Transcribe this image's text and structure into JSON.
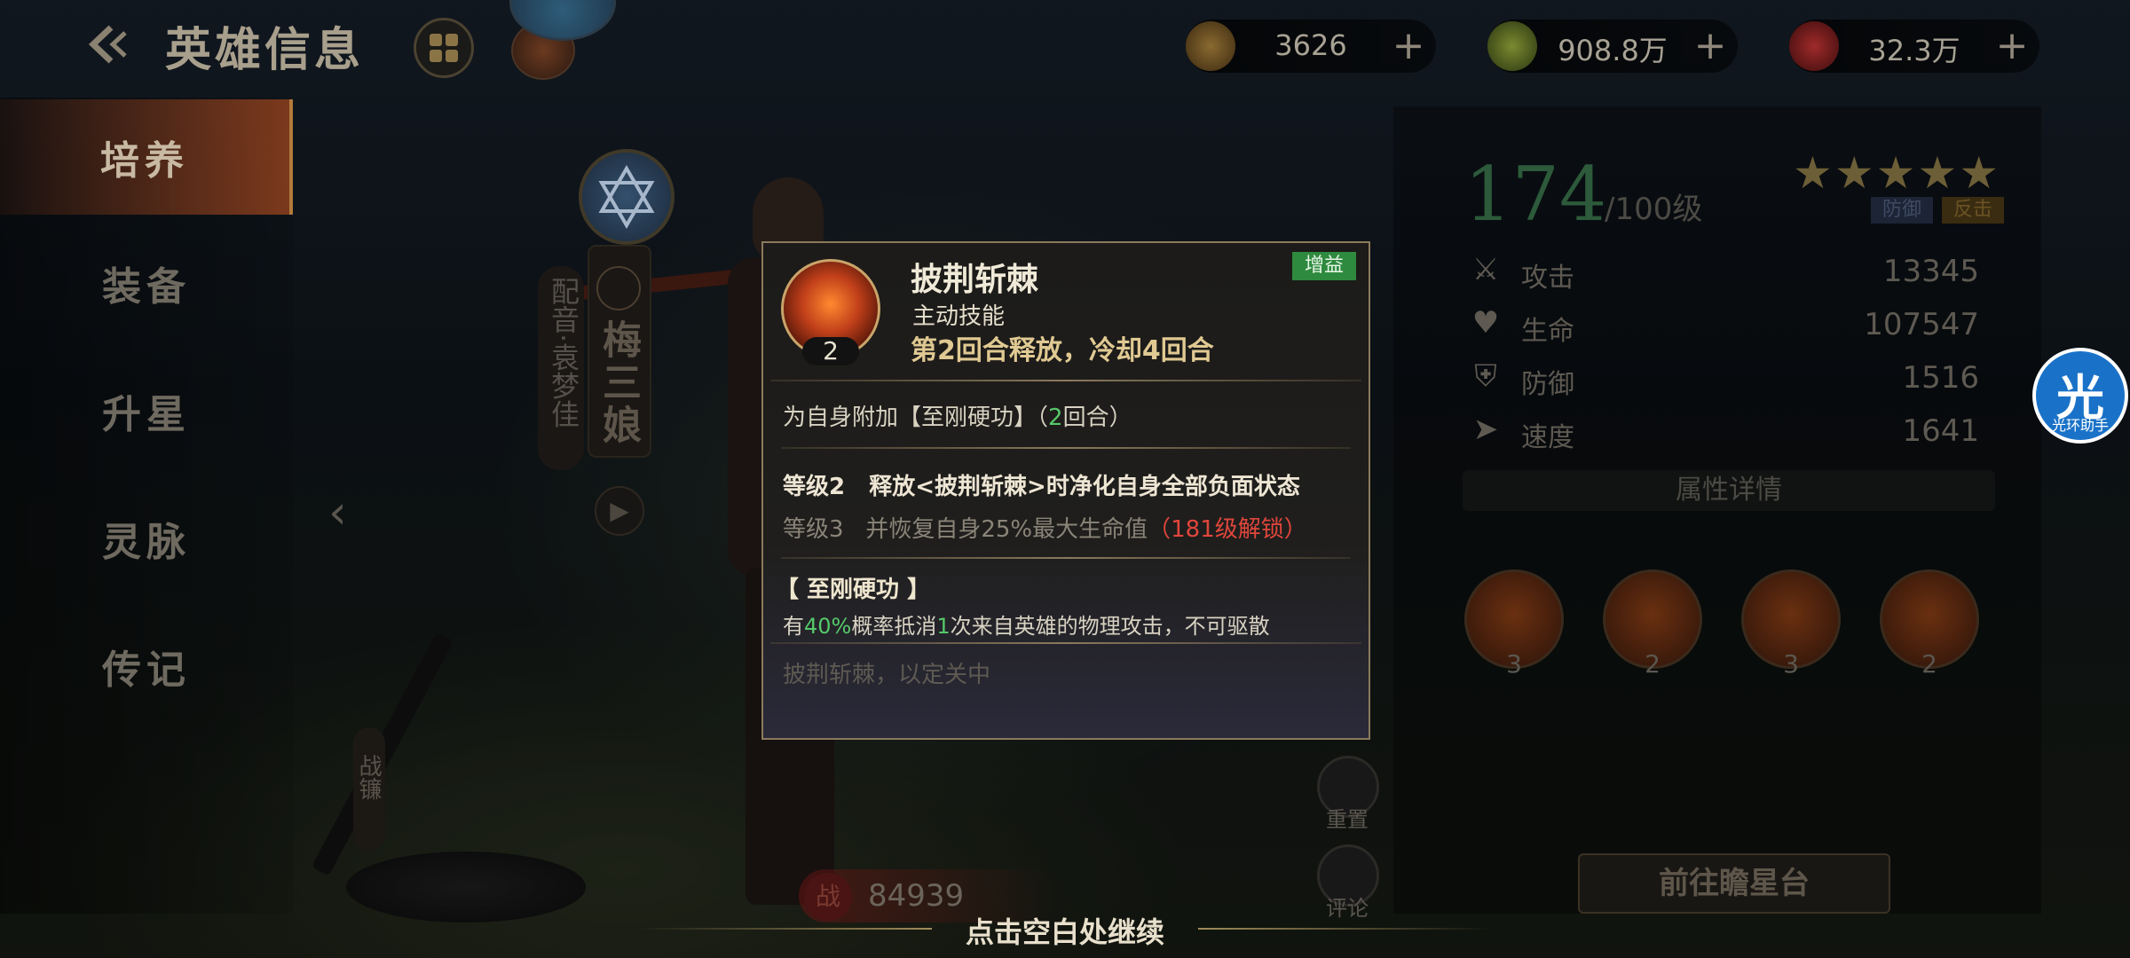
{
  "header": {
    "title": "英雄信息",
    "resources": [
      {
        "value": "3626",
        "icon": "gold-ingot-icon"
      },
      {
        "value": "908.8万",
        "icon": "jade-coin-icon"
      },
      {
        "value": "32.3万",
        "icon": "red-gem-icon"
      }
    ]
  },
  "nav": {
    "items": [
      "培养",
      "装备",
      "升星",
      "灵脉",
      "传记"
    ],
    "active": "培养"
  },
  "hero": {
    "name": "梅三娘",
    "voice": "配音·袁梦佳",
    "power": "84939",
    "power_icon_char": "战",
    "weapon_tag": "战镰"
  },
  "actions": {
    "reset": "重置",
    "comment": "评论"
  },
  "stats_panel": {
    "level": "174",
    "level_max": "/100级",
    "stars": "★★★★★",
    "tags": [
      "防御",
      "反击"
    ],
    "stats": [
      {
        "label": "攻击",
        "value": "13345",
        "icon": "crossed-swords-icon"
      },
      {
        "label": "生命",
        "value": "107547",
        "icon": "heart-icon"
      },
      {
        "label": "防御",
        "value": "1516",
        "icon": "shield-icon"
      },
      {
        "label": "速度",
        "value": "1641",
        "icon": "boot-icon"
      }
    ],
    "attr_detail": "属性详情",
    "skill_levels": [
      "3",
      "2",
      "3",
      "2"
    ],
    "goto_button": "前往瞻星台"
  },
  "helper": {
    "glyph": "光",
    "label": "光环助手"
  },
  "popup": {
    "skill_name": "披荆斩棘",
    "skill_type": "主动技能",
    "skill_level": "2",
    "cooldown": "第2回合释放，冷却4回合",
    "badge": "增益",
    "effect_pre": "为自身附加【至刚硬功】（",
    "effect_num": "2",
    "effect_post": "回合）",
    "lv2_label": "等级2",
    "lv2_text": "释放<披荆斩棘>时净化自身全部负面状态",
    "lv3_label": "等级3",
    "lv3_text": "并恢复自身25%最大生命值",
    "lv3_lock": "（181级解锁）",
    "buff_title": "【 至刚硬功 】",
    "buff_a": "有",
    "buff_pct": "40%",
    "buff_b": "概率抵消",
    "buff_n": "1",
    "buff_c": "次来自英雄的物理攻击，不可驱散",
    "flavor": "披荆斩棘，以定关中"
  },
  "continue_hint": "点击空白处继续"
}
